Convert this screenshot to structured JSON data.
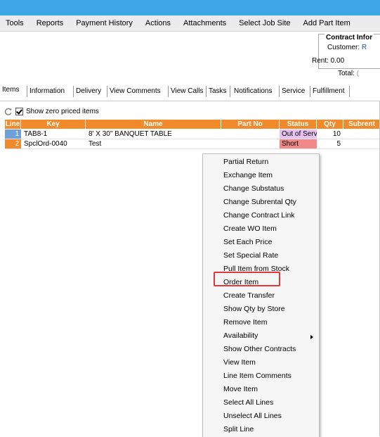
{
  "menubar": {
    "items": [
      "Tools",
      "Reports",
      "Payment History",
      "Actions",
      "Attachments",
      "Select Job Site",
      "Add Part Item"
    ]
  },
  "contract": {
    "title": "Contract Infor",
    "customer_label": "Customer:",
    "customer_value": "R",
    "rent": "Rent: 0.00",
    "total_label": "Total:",
    "total_value": "("
  },
  "tabs": [
    "Items",
    "Information",
    "Delivery",
    "View Comments",
    "View Calls",
    "Tasks",
    "Notifications",
    "Service",
    "Fulfillment"
  ],
  "toolbar": {
    "refresh_icon": "refresh-icon",
    "show_zero_label": "Show zero priced items",
    "show_zero_checked": true
  },
  "grid": {
    "headers": [
      "Line",
      "Key",
      "Name",
      "Part No",
      "Status",
      "Qty",
      "Subrent"
    ],
    "rows": [
      {
        "line": "1",
        "key": "TAB8-1",
        "name": "8' X 30\" BANQUET TABLE",
        "part_no": "",
        "status": "Out of Serv",
        "qty": "10",
        "subrent": ""
      },
      {
        "line": "2",
        "key": "SpclOrd-0040",
        "name": "Test",
        "part_no": "",
        "status": "Short",
        "qty": "5",
        "subrent": ""
      }
    ],
    "colors": {
      "header": "#f08a2a",
      "row1_line": "#6fa0d8",
      "row2_line": "#f08a2a",
      "status_out": "#e6c3f0",
      "status_short": "#f08a8a"
    }
  },
  "context_menu": {
    "items": [
      "Partial Return",
      "Exchange Item",
      "Change Substatus",
      "Change Subrental Qty",
      "Change Contract Link",
      "Create WO Item",
      "Set Each Price",
      "Set Special Rate",
      "Pull Item from Stock",
      "Order Item",
      "Create Transfer",
      "Show Qty by Store",
      "Remove Item",
      "Availability",
      "Show Other Contracts",
      "View Item",
      "Line Item Comments",
      "Move Item",
      "Select All Lines",
      "Unselect All Lines",
      "Split Line"
    ],
    "highlighted": "Order Item",
    "submenu_item": "Availability",
    "highlight_color": "#e0383b"
  }
}
